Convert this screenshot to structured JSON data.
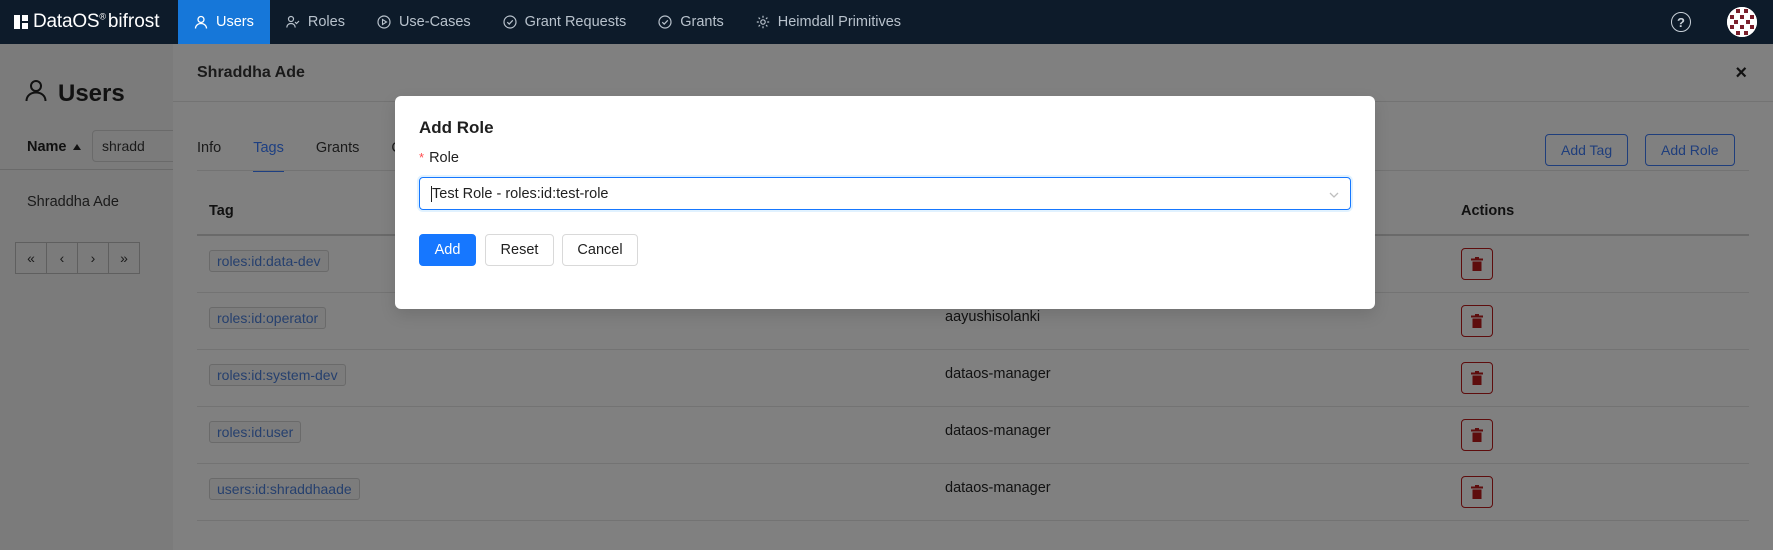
{
  "brand": {
    "name": "DataOS",
    "reg": "®",
    "product": "bifrost"
  },
  "nav": {
    "items": [
      {
        "label": "Users",
        "icon": "user-icon",
        "active": true
      },
      {
        "label": "Roles",
        "icon": "roles-icon",
        "active": false
      },
      {
        "label": "Use-Cases",
        "icon": "play-circle-icon",
        "active": false
      },
      {
        "label": "Grant Requests",
        "icon": "check-circle-icon",
        "active": false
      },
      {
        "label": "Grants",
        "icon": "check-circle-icon",
        "active": false
      },
      {
        "label": "Heimdall Primitives",
        "icon": "gear-icon",
        "active": false
      }
    ],
    "help": "?"
  },
  "users_page": {
    "title": "Users",
    "column_name": "Name",
    "filter_value": "shradd",
    "rows": [
      "Shraddha Ade"
    ],
    "pager": {
      "first": "«",
      "prev": "‹",
      "next": "›",
      "last": "»"
    }
  },
  "drawer": {
    "title": "Shraddha Ade",
    "close": "×",
    "tabs": [
      {
        "label": "Info",
        "active": false
      },
      {
        "label": "Tags",
        "active": true
      },
      {
        "label": "Grants",
        "active": false
      },
      {
        "label": "C",
        "active": false
      }
    ],
    "add_tag_label": "Add Tag",
    "add_role_label": "Add Role",
    "table": {
      "headers": {
        "tag": "Tag",
        "actions": "Actions"
      },
      "rows": [
        {
          "tag": "roles:id:data-dev",
          "created_by": ""
        },
        {
          "tag": "roles:id:operator",
          "created_by": "aayushisolanki"
        },
        {
          "tag": "roles:id:system-dev",
          "created_by": "dataos-manager"
        },
        {
          "tag": "roles:id:user",
          "created_by": "dataos-manager"
        },
        {
          "tag": "users:id:shraddhaade",
          "created_by": "dataos-manager"
        }
      ]
    }
  },
  "modal": {
    "title": "Add Role",
    "field_label": "Role",
    "required_mark": "*",
    "selected_value": "Test Role - roles:id:test-role",
    "buttons": {
      "add": "Add",
      "reset": "Reset",
      "cancel": "Cancel"
    }
  },
  "colors": {
    "nav_bg": "#0d1b2a",
    "nav_active": "#1677d9",
    "primary": "#1677ff",
    "danger": "#5e0d0d"
  }
}
